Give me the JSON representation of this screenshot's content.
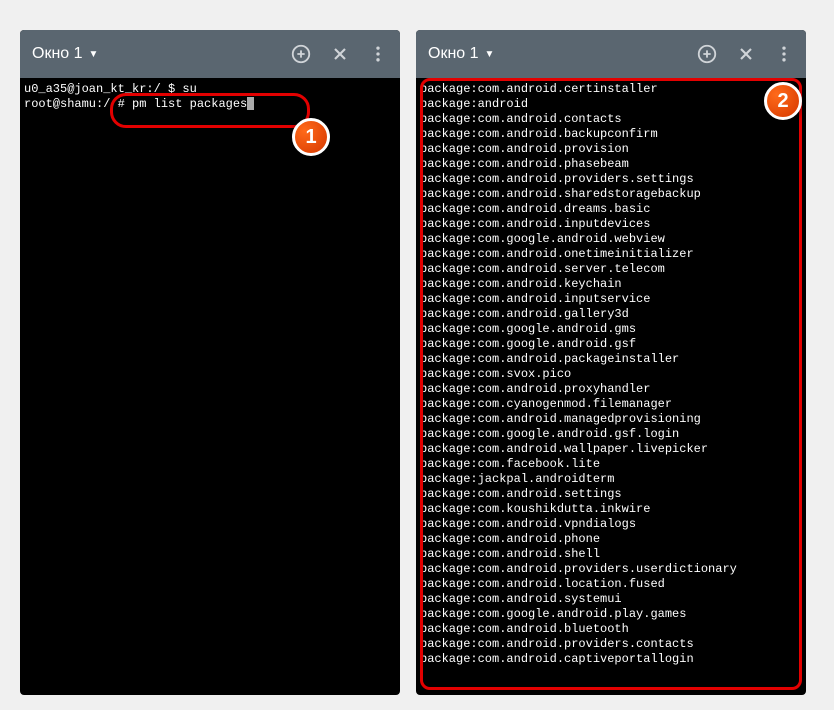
{
  "titlebar": {
    "window_label": "Окно 1"
  },
  "left_terminal": {
    "line1_user": "u0_a35@joan_kt_kr:/",
    "line1_suffix": " $ su",
    "line2_user": "root@shamu:/",
    "line2_cmd": " # pm list packages"
  },
  "badges": {
    "one": "1",
    "two": "2"
  },
  "packages": [
    "package:com.android.certinstaller",
    "package:android",
    "package:com.android.contacts",
    "package:com.android.backupconfirm",
    "package:com.android.provision",
    "package:com.android.phasebeam",
    "package:com.android.providers.settings",
    "package:com.android.sharedstoragebackup",
    "package:com.android.dreams.basic",
    "package:com.android.inputdevices",
    "package:com.google.android.webview",
    "package:com.android.onetimeinitializer",
    "package:com.android.server.telecom",
    "package:com.android.keychain",
    "package:com.android.inputservice",
    "package:com.android.gallery3d",
    "package:com.google.android.gms",
    "package:com.google.android.gsf",
    "package:com.android.packageinstaller",
    "package:com.svox.pico",
    "package:com.android.proxyhandler",
    "package:com.cyanogenmod.filemanager",
    "package:com.android.managedprovisioning",
    "package:com.google.android.gsf.login",
    "package:com.android.wallpaper.livepicker",
    "package:com.facebook.lite",
    "package:jackpal.androidterm",
    "package:com.android.settings",
    "package:com.koushikdutta.inkwire",
    "package:com.android.vpndialogs",
    "package:com.android.phone",
    "package:com.android.shell",
    "package:com.android.providers.userdictionary",
    "package:com.android.location.fused",
    "package:com.android.systemui",
    "package:com.google.android.play.games",
    "package:com.android.bluetooth",
    "package:com.android.providers.contacts",
    "package:com.android.captiveportallogin"
  ]
}
